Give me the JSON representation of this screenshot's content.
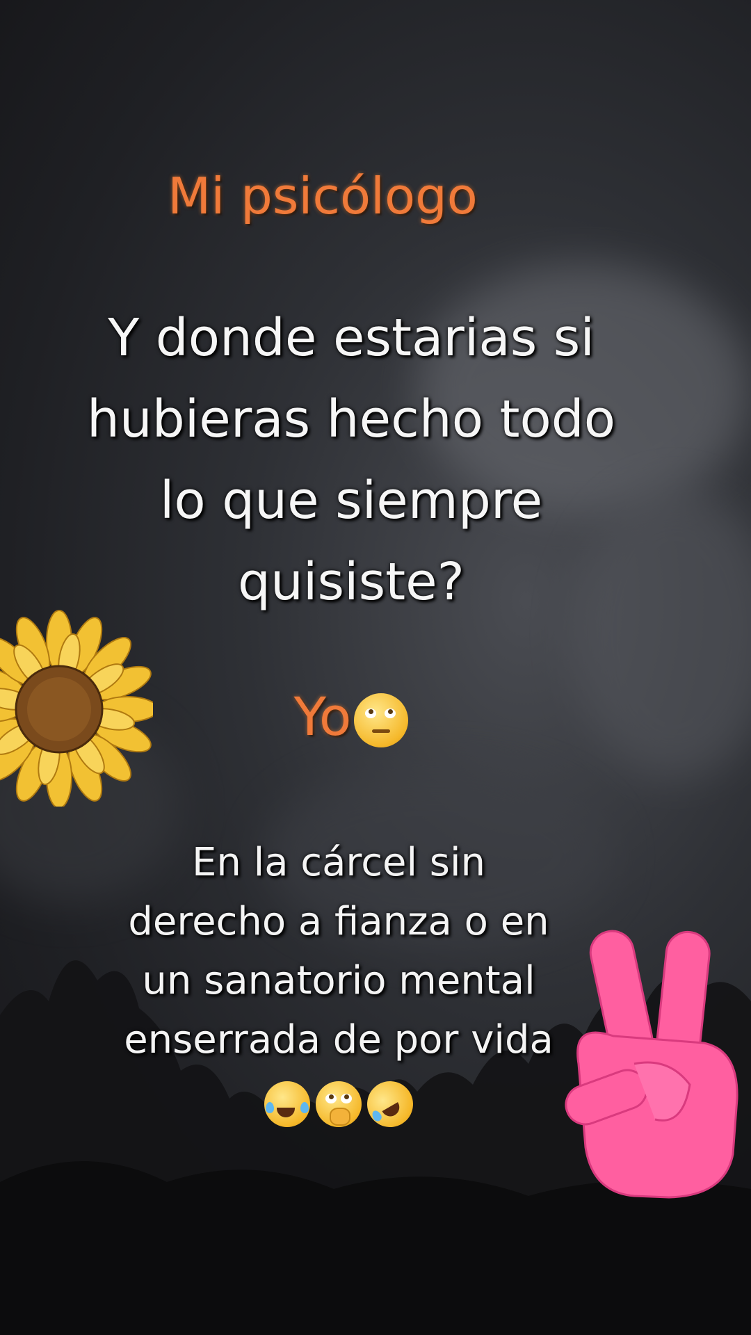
{
  "title": "Mi psicólogo",
  "question_lines": [
    "Y donde estarias si",
    "hubieras hecho todo",
    "lo que siempre",
    "quisiste?"
  ],
  "yo_label": "Yo",
  "answer_lines": [
    "En la cárcel sin",
    "derecho a fianza o en",
    "un sanatorio mental",
    "enserrada de por vida"
  ],
  "emojis": {
    "after_yo": "face-with-rolling-eyes",
    "final": [
      "face-with-tears-of-joy",
      "face-with-hand-over-mouth",
      "rolling-on-the-floor-laughing"
    ]
  },
  "stickers": [
    "sunflower",
    "peace-sign-hand"
  ],
  "colors": {
    "accent_orange": "#f07a3a",
    "text_white": "#f6f6f6",
    "peace_pink": "#ff5fa0"
  }
}
